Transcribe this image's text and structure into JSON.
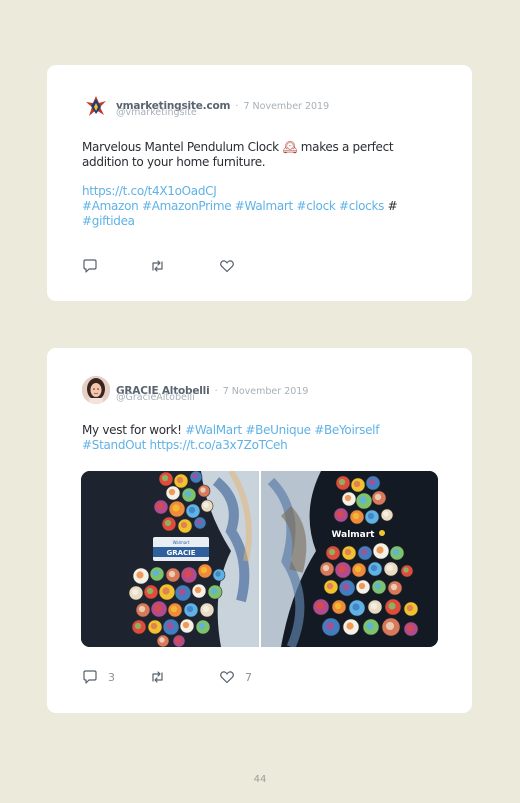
{
  "page_number": "44",
  "tweets": [
    {
      "display_name": "vmarketingsite.com",
      "separator": "·",
      "date": "7 November 2019",
      "username": "@vmarketingsite",
      "text_before_emoji": "Marvelous Mantel Pendulum Clock",
      "emoji": "🕰",
      "text_after_emoji": "makes a perfect addition to your home furniture.",
      "link": "https://t.co/t4X1oOadCJ",
      "hashtags_line1": "#Amazon #AmazonPrime #Walmart #clock #clocks",
      "hash_plain": "#",
      "hashtags_line2": "#giftidea",
      "reply_count": "",
      "retweet_count": "",
      "like_count": ""
    },
    {
      "display_name": "GRACIE Altobelli",
      "separator": "·",
      "date": "7 November 2019",
      "username": "@GracieAltobelli",
      "text_plain": "My vest for work!",
      "hashtags_line1": "#WalMart #BeUnique #BeYoirself",
      "hashtags_line2": "#StandOut https://t.co/a3x7ZoTCeh",
      "reply_count": "3",
      "retweet_count": "",
      "like_count": "7"
    }
  ],
  "colors": {
    "background": "#ecebdb",
    "card": "#ffffff",
    "link": "#5fb2e6",
    "muted": "#a6b0b8"
  },
  "icons": [
    "reply-icon",
    "retweet-icon",
    "like-icon"
  ]
}
